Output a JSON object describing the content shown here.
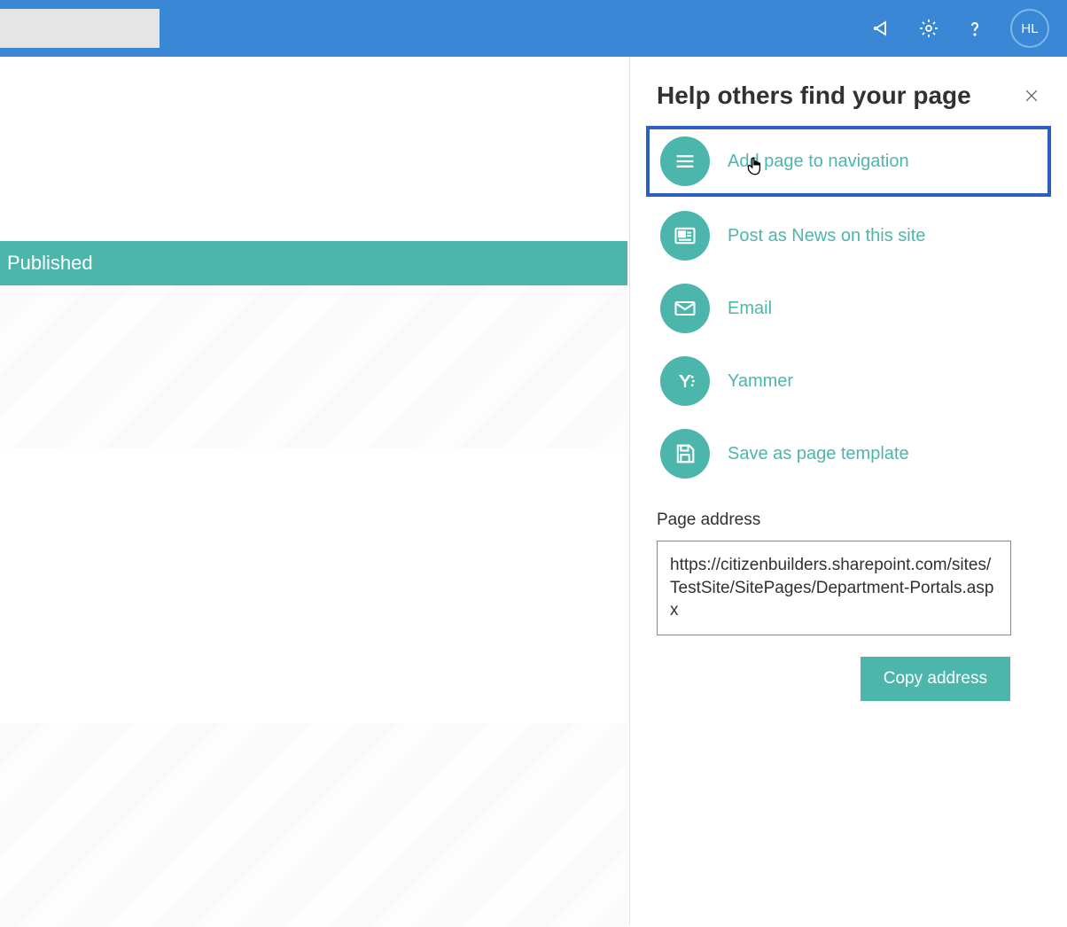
{
  "header": {
    "avatar_initials": "HL"
  },
  "banner": {
    "text": "Published"
  },
  "panel": {
    "title": "Help others find your page",
    "options": [
      {
        "icon": "hamburger-icon",
        "label": "Add page to navigation"
      },
      {
        "icon": "news-icon",
        "label": "Post as News on this site"
      },
      {
        "icon": "email-icon",
        "label": "Email"
      },
      {
        "icon": "yammer-icon",
        "label": "Yammer"
      },
      {
        "icon": "save-icon",
        "label": "Save as page template"
      }
    ],
    "address_label": "Page address",
    "address_value": "https://citizenbuilders.sharepoint.com/sites/TestSite/SitePages/Department-Portals.aspx",
    "copy_button": "Copy address"
  }
}
